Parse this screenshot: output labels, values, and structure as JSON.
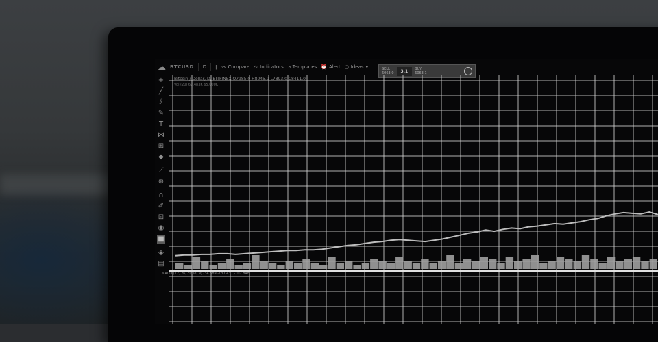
{
  "toolbar": {
    "symbol": "BTCUSD",
    "interval": "D",
    "compare_label": "Compare",
    "indicators_label": "Indicators",
    "templates_label": "Templates",
    "alert_label": "Alert",
    "ideas_label": "Ideas"
  },
  "trade_panel": {
    "sell_label": "SELL",
    "sell_price": "6063.0",
    "quantity": "3.1",
    "buy_label": "BUY",
    "buy_price": "6063.1"
  },
  "chart_header": {
    "title": "Bitcoin / Dollar, D, BITFINEX",
    "ohlc": "O7985.0 H8045.9 L7893.0 C8411.0",
    "volume": "Vol (20) 67.483K 65.000K"
  },
  "indicator_header": {
    "text": "MACD (12, 26, close, 9)",
    "values": "-34.589 -137.437 -102.848"
  },
  "sidebar_icons": [
    "crosshair-icon",
    "trend-line-icon",
    "pitchfork-icon",
    "brush-icon",
    "text-icon",
    "pattern-icon",
    "prediction-icon",
    "shapes-icon",
    "ruler-icon",
    "zoom-icon",
    "magnet-icon",
    "stay-in-drawing-icon",
    "lock-icon",
    "eye-icon",
    "remove-drawings-icon",
    "object-tree-icon",
    "trash-icon"
  ],
  "colors": {
    "background": "#070708",
    "grid": "#cfcfcf",
    "line": "#bdbdbd",
    "volume": "#a0a0a0"
  },
  "chart_data": {
    "type": "line",
    "series": [
      {
        "values": [
          0.12,
          0.13,
          0.13,
          0.14,
          0.14,
          0.15,
          0.15,
          0.14,
          0.15,
          0.16,
          0.17,
          0.18,
          0.19,
          0.2,
          0.2,
          0.21,
          0.21,
          0.22,
          0.24,
          0.26,
          0.28,
          0.29,
          0.31,
          0.33,
          0.34,
          0.36,
          0.37,
          0.36,
          0.35,
          0.34,
          0.36,
          0.38,
          0.41,
          0.44,
          0.47,
          0.49,
          0.52,
          0.5,
          0.53,
          0.55,
          0.54,
          0.57,
          0.58,
          0.6,
          0.62,
          0.61,
          0.63,
          0.65,
          0.68,
          0.7,
          0.74,
          0.77,
          0.79,
          0.78,
          0.77,
          0.8,
          0.76
        ]
      }
    ],
    "volume": [
      0.3,
      0.2,
      0.6,
      0.4,
      0.2,
      0.3,
      0.5,
      0.2,
      0.3,
      0.7,
      0.4,
      0.3,
      0.2,
      0.4,
      0.3,
      0.5,
      0.3,
      0.2,
      0.6,
      0.3,
      0.4,
      0.2,
      0.3,
      0.5,
      0.4,
      0.3,
      0.6,
      0.4,
      0.3,
      0.5,
      0.3,
      0.4,
      0.7,
      0.3,
      0.5,
      0.4,
      0.6,
      0.5,
      0.3,
      0.6,
      0.4,
      0.5,
      0.7,
      0.3,
      0.4,
      0.6,
      0.5,
      0.4,
      0.7,
      0.5,
      0.3,
      0.6,
      0.4,
      0.5,
      0.6,
      0.4,
      0.5
    ],
    "grid": true
  }
}
